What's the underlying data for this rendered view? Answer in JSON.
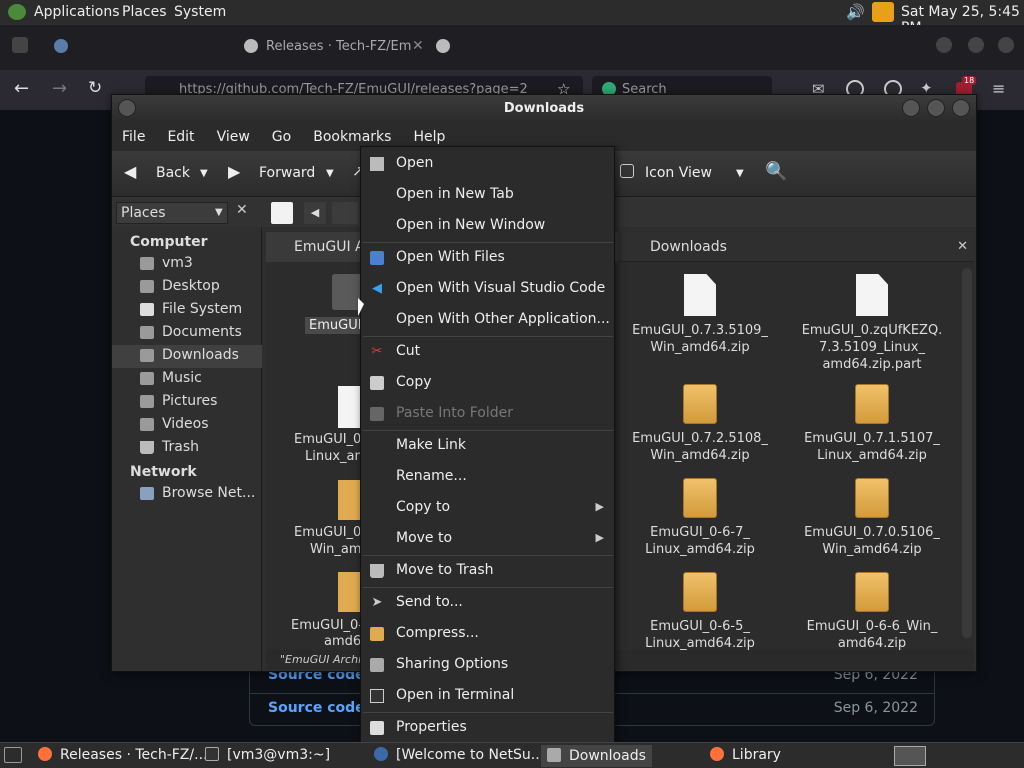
{
  "top_panel": {
    "applications": "Applications",
    "places": "Places",
    "system": "System",
    "clock": "Sat May 25,  5:45 PM"
  },
  "firefox": {
    "tab_active": "Releases · Tech-FZ/Em",
    "url": "https://github.com/Tech-FZ/EmuGUI/releases?page=2",
    "search_placeholder": "Search",
    "notif_count": "18",
    "rows": [
      {
        "label": "Source code",
        "date": "Sep 6, 2022"
      },
      {
        "label": "Source code",
        "date": "Sep 6, 2022"
      }
    ]
  },
  "window": {
    "title": "Downloads"
  },
  "menubar": [
    "File",
    "Edit",
    "View",
    "Go",
    "Bookmarks",
    "Help"
  ],
  "toolbar": {
    "back": "Back",
    "forward": "Forward",
    "view": "Icon View"
  },
  "side_pane": {
    "selector": "Places",
    "computer_header": "Computer",
    "network_header": "Network",
    "items": [
      "vm3",
      "Desktop",
      "File System",
      "Documents",
      "Downloads",
      "Music",
      "Pictures",
      "Videos",
      "Trash"
    ],
    "network_items": [
      "Browse Net..."
    ]
  },
  "pane_left": {
    "tab": "EmuGUI Ar",
    "folder_label": "EmuGUI",
    "files": [
      "EmuGUI_0",
      "Linux_am",
      "EmuGUI_0",
      "Win_am",
      "EmuGUI_0-",
      "amd6"
    ],
    "status": "\"EmuGUI Archive\""
  },
  "pane_right": {
    "tab": "Downloads",
    "files": [
      {
        "line1": "EmuGUI_0.7.3.5109_",
        "line2": "Win_amd64.zip",
        "line3": "",
        "kind": "doc"
      },
      {
        "line1": "EmuGUI_0.zqUfKEZQ.",
        "line2": "7.3.5109_Linux_",
        "line3": "amd64.zip.part",
        "kind": "doc"
      },
      {
        "line1": "EmuGUI_0.7.2.5108_",
        "line2": "Win_amd64.zip",
        "line3": "",
        "kind": "box"
      },
      {
        "line1": "EmuGUI_0.7.1.5107_",
        "line2": "Linux_amd64.zip",
        "line3": "",
        "kind": "box"
      },
      {
        "line1": "EmuGUI_0-6-7_",
        "line2": "Linux_amd64.zip",
        "line3": "",
        "kind": "box"
      },
      {
        "line1": "EmuGUI_0.7.0.5106_",
        "line2": "Win_amd64.zip",
        "line3": "",
        "kind": "box"
      },
      {
        "line1": "EmuGUI_0-6-5_",
        "line2": "Linux_amd64.zip",
        "line3": "",
        "kind": "box"
      },
      {
        "line1": "EmuGUI_0-6-6_Win_",
        "line2": "amd64.zip",
        "line3": "",
        "kind": "box"
      }
    ]
  },
  "context_menu": {
    "open": "Open",
    "open_tab": "Open in New Tab",
    "open_window": "Open in New Window",
    "open_files": "Open With Files",
    "open_vscode": "Open With Visual Studio Code",
    "open_other": "Open With Other Application...",
    "cut": "Cut",
    "copy": "Copy",
    "paste": "Paste Into Folder",
    "make_link": "Make Link",
    "rename": "Rename...",
    "copy_to": "Copy to",
    "move_to": "Move to",
    "trash": "Move to Trash",
    "send_to": "Send to...",
    "compress": "Compress...",
    "sharing": "Sharing Options",
    "terminal": "Open in Terminal",
    "properties": "Properties"
  },
  "taskbar": {
    "t1": "Releases · Tech-FZ/...",
    "t2": "[vm3@vm3:~]",
    "t3": "[Welcome to NetSu...",
    "t4": "Downloads",
    "t5": "Library"
  },
  "colors": {
    "accent_link": "#58a6ff",
    "firefox_orange": "#ff7139",
    "selection": "#404040"
  }
}
